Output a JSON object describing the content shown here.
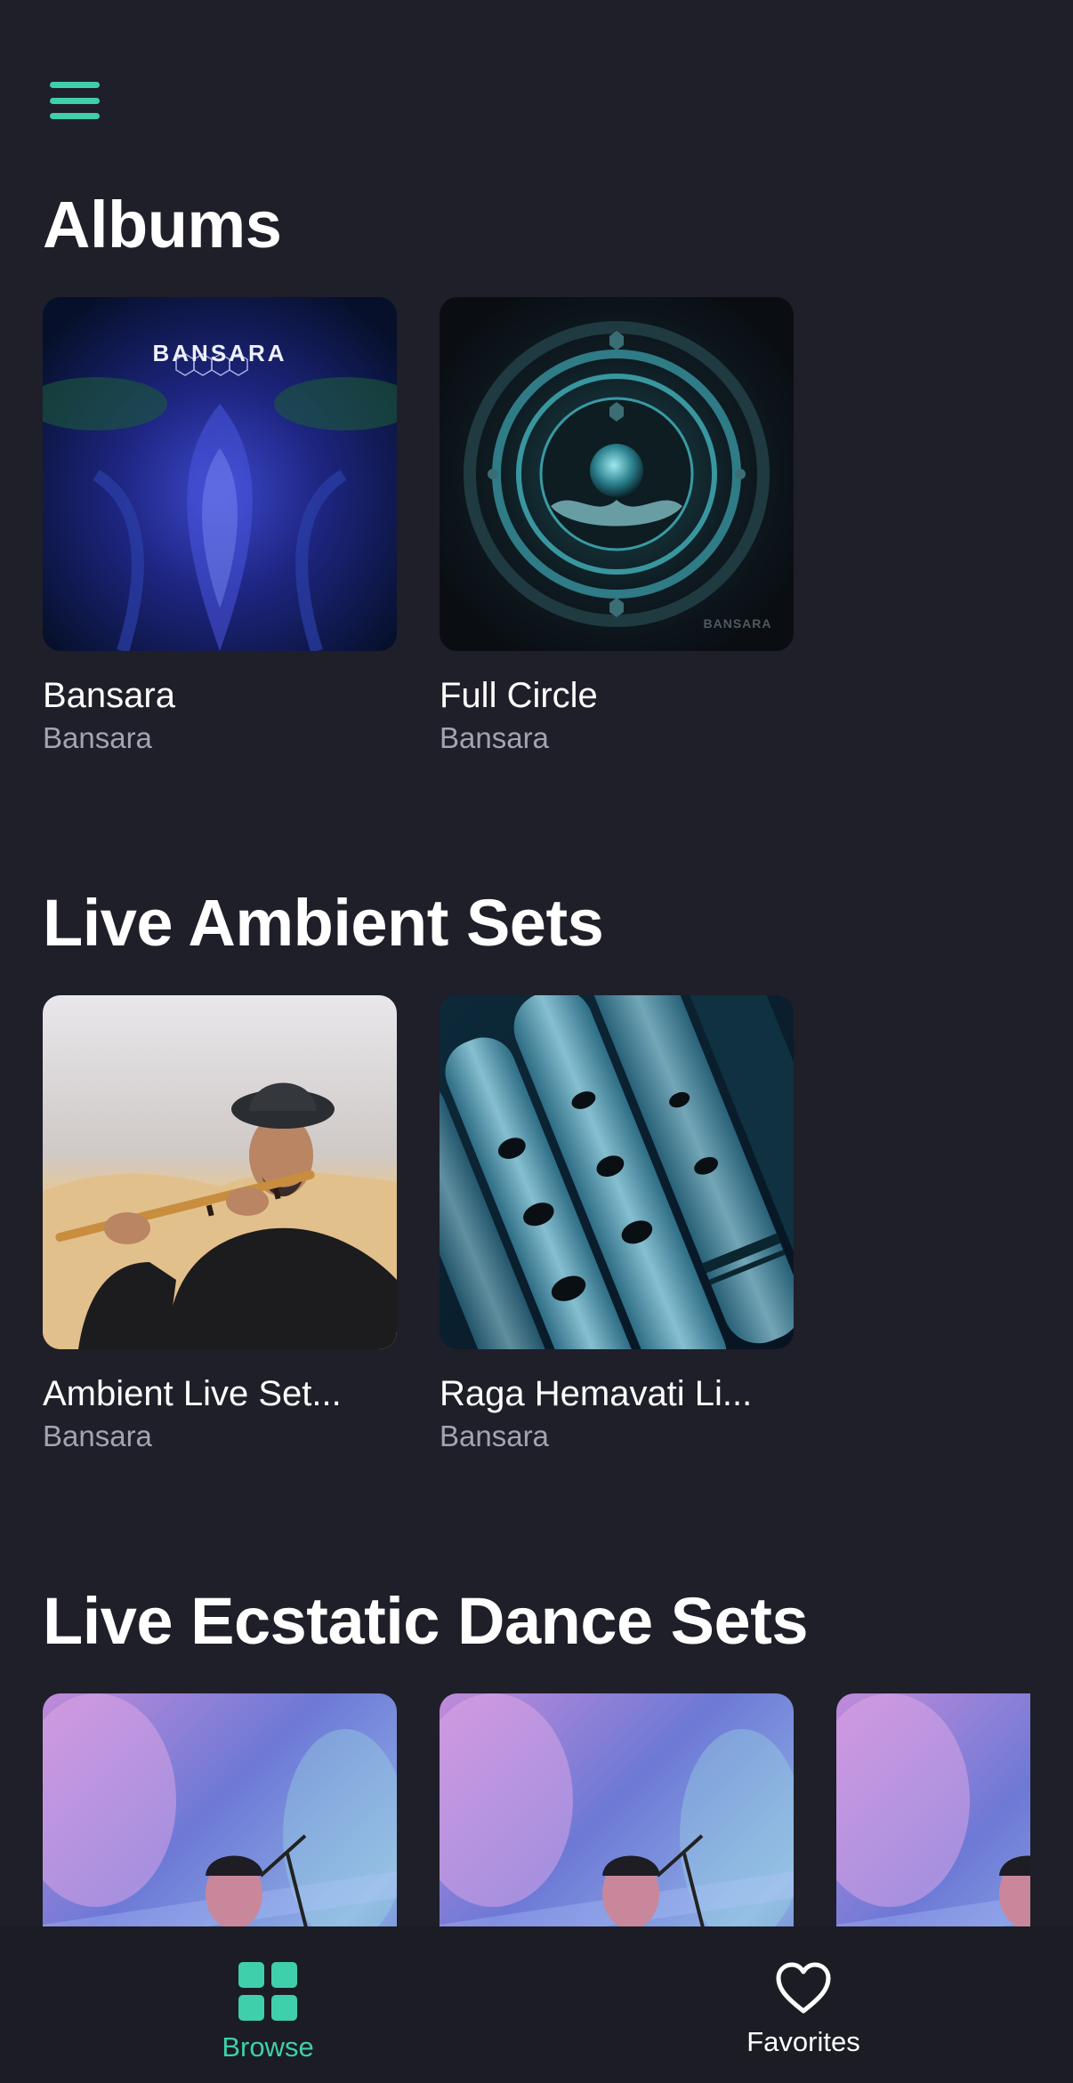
{
  "header": {
    "menu_icon": "hamburger-menu-icon",
    "accent_color": "#3fcfaa"
  },
  "sections": [
    {
      "title": "Albums",
      "items": [
        {
          "title": "Bansara",
          "artist": "Bansara",
          "cover_text": "BANSARA"
        },
        {
          "title": "Full Circle",
          "artist": "Bansara",
          "cover_text": "BANSARA"
        }
      ]
    },
    {
      "title": "Live Ambient Sets",
      "items": [
        {
          "title": "Ambient Live Set...",
          "artist": "Bansara"
        },
        {
          "title": "Raga Hemavati Li...",
          "artist": "Bansara"
        }
      ]
    },
    {
      "title": "Live Ecstatic Dance Sets",
      "items": [
        {},
        {},
        {}
      ]
    }
  ],
  "tabbar": {
    "browse": {
      "label": "Browse",
      "icon": "grid-icon",
      "active": true
    },
    "favorites": {
      "label": "Favorites",
      "icon": "heart-icon",
      "active": false
    }
  },
  "colors": {
    "background": "#1f1f29",
    "accent": "#3fcfaa",
    "secondary_text": "#a4a4b0"
  }
}
